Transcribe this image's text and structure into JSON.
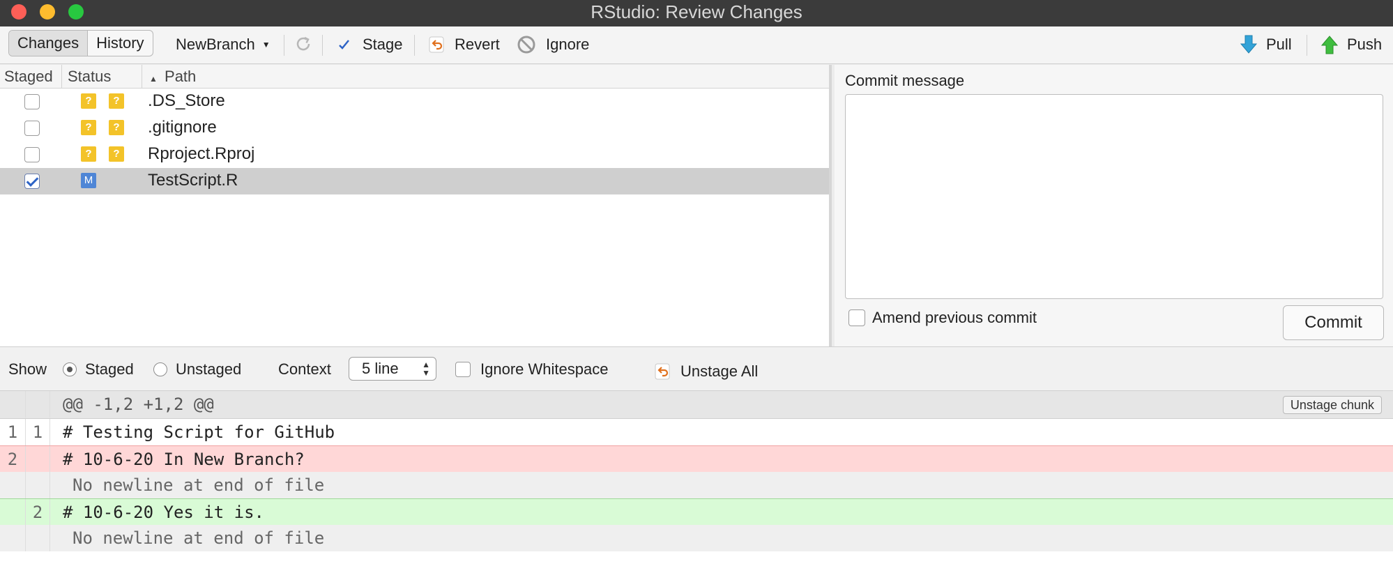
{
  "window": {
    "title": "RStudio: Review Changes"
  },
  "toolbar": {
    "tabs": [
      {
        "label": "Changes",
        "active": true
      },
      {
        "label": "History",
        "active": false
      }
    ],
    "branch": "NewBranch",
    "stage_label": "Stage",
    "revert_label": "Revert",
    "ignore_label": "Ignore",
    "pull_label": "Pull",
    "push_label": "Push"
  },
  "file_list": {
    "columns": {
      "staged": "Staged",
      "status": "Status",
      "path": "Path"
    },
    "rows": [
      {
        "staged": false,
        "status": [
          "?",
          "?"
        ],
        "path": ".DS_Store"
      },
      {
        "staged": false,
        "status": [
          "?",
          "?"
        ],
        "path": ".gitignore"
      },
      {
        "staged": false,
        "status": [
          "?",
          "?"
        ],
        "path": "Rproject.Rproj"
      },
      {
        "staged": true,
        "status": [
          "M"
        ],
        "path": "TestScript.R",
        "selected": true
      }
    ]
  },
  "commit": {
    "message_label": "Commit message",
    "message_value": "",
    "amend_label": "Amend previous commit",
    "commit_button": "Commit"
  },
  "diff_options": {
    "show_label": "Show",
    "staged_label": "Staged",
    "unstaged_label": "Unstaged",
    "context_label": "Context",
    "context_value": "5 line",
    "ignore_whitespace_label": "Ignore Whitespace",
    "unstage_all_label": "Unstage All"
  },
  "diff": {
    "hunk_header": "@@ -1,2 +1,2 @@",
    "unstage_chunk_label": "Unstage chunk",
    "lines": [
      {
        "type": "ctx",
        "old": "1",
        "new": "1",
        "text": "# Testing Script for GitHub"
      },
      {
        "type": "del",
        "old": "2",
        "new": "",
        "text": "# 10-6-20 In New Branch?"
      },
      {
        "type": "nonl",
        "old": "",
        "new": "",
        "text": "No newline at end of file"
      },
      {
        "type": "add",
        "old": "",
        "new": "2",
        "text": "# 10-6-20 Yes it is."
      },
      {
        "type": "nonl",
        "old": "",
        "new": "",
        "text": "No newline at end of file"
      }
    ]
  },
  "colors": {
    "deleted_bg": "#ffd7d7",
    "added_bg": "#d9fbd6",
    "untracked_badge": "#f3c329",
    "modified_badge": "#4f86d6"
  }
}
